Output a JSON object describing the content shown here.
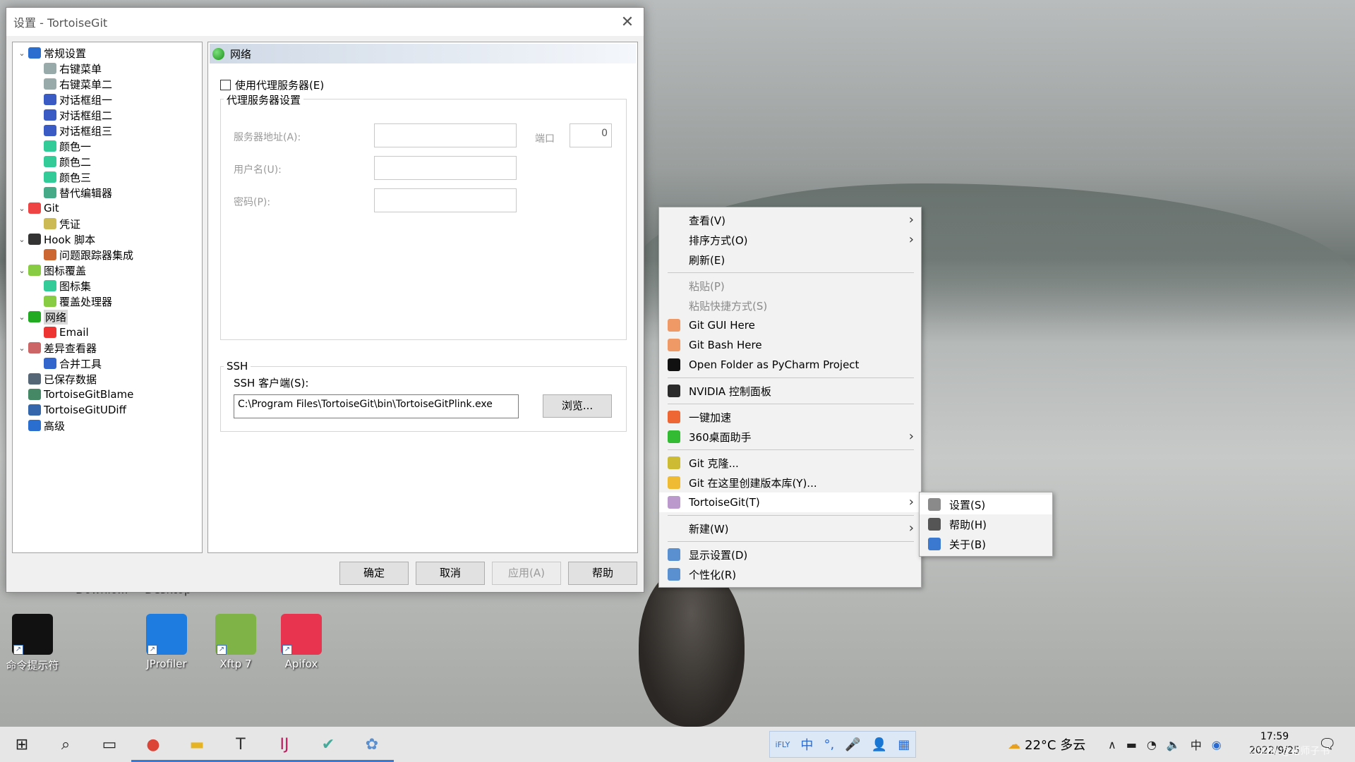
{
  "window": {
    "title": "设置 - TortoiseGit",
    "close": "✕"
  },
  "tree": [
    {
      "label": "常规设置",
      "icon": "wrench-icon",
      "level": 0,
      "exp": "v",
      "c": "#2a6fd0"
    },
    {
      "label": "右键菜单",
      "icon": "gear-icon",
      "level": 1,
      "c": "#9aa"
    },
    {
      "label": "右键菜单二",
      "icon": "gear-icon",
      "level": 1,
      "c": "#9aa"
    },
    {
      "label": "对话框组一",
      "icon": "windows-icon",
      "level": 1,
      "c": "#3b5bc4"
    },
    {
      "label": "对话框组二",
      "icon": "windows-icon",
      "level": 1,
      "c": "#3b5bc4"
    },
    {
      "label": "对话框组三",
      "icon": "windows-icon",
      "level": 1,
      "c": "#3b5bc4"
    },
    {
      "label": "颜色一",
      "icon": "palette-icon",
      "level": 1,
      "c": "#3c9"
    },
    {
      "label": "颜色二",
      "icon": "palette-icon",
      "level": 1,
      "c": "#3c9"
    },
    {
      "label": "颜色三",
      "icon": "palette-icon",
      "level": 1,
      "c": "#3c9"
    },
    {
      "label": "替代编辑器",
      "icon": "editor-icon",
      "level": 1,
      "c": "#4a8"
    },
    {
      "label": "Git",
      "icon": "git-icon",
      "level": 0,
      "exp": "v",
      "c": "#e44"
    },
    {
      "label": "凭证",
      "icon": "key-icon",
      "level": 1,
      "c": "#cb5"
    },
    {
      "label": "Hook 脚本",
      "icon": "hook-icon",
      "level": 0,
      "exp": "v",
      "c": "#333"
    },
    {
      "label": "问题跟踪器集成",
      "icon": "bug-icon",
      "level": 1,
      "c": "#c63"
    },
    {
      "label": "图标覆盖",
      "icon": "overlay-icon",
      "level": 0,
      "exp": "v",
      "c": "#8c4"
    },
    {
      "label": "图标集",
      "icon": "iconset-icon",
      "level": 1,
      "c": "#3c9"
    },
    {
      "label": "覆盖处理器",
      "icon": "overlay-handler-icon",
      "level": 1,
      "c": "#8c4"
    },
    {
      "label": "网络",
      "icon": "globe-icon",
      "level": 0,
      "exp": "v",
      "c": "#2a2",
      "sel": true
    },
    {
      "label": "Email",
      "icon": "at-icon",
      "level": 1,
      "c": "#e33"
    },
    {
      "label": "差异查看器",
      "icon": "magnifier-icon",
      "level": 0,
      "exp": "v",
      "c": "#c66"
    },
    {
      "label": "合并工具",
      "icon": "merge-icon",
      "level": 1,
      "c": "#36c"
    },
    {
      "label": "已保存数据",
      "icon": "gear-icon",
      "level": 0,
      "c": "#567"
    },
    {
      "label": "TortoiseGitBlame",
      "icon": "blame-icon",
      "level": 0,
      "c": "#486"
    },
    {
      "label": "TortoiseGitUDiff",
      "icon": "udiff-icon",
      "level": 0,
      "c": "#36a"
    },
    {
      "label": "高级",
      "icon": "wrench-icon",
      "level": 0,
      "c": "#2a6fd0"
    }
  ],
  "panel": {
    "header": "网络",
    "use_proxy": "使用代理服务器(E)",
    "proxy_group": "代理服务器设置",
    "server_label": "服务器地址(A):",
    "port_label": "端口",
    "port_value": "0",
    "user_label": "用户名(U):",
    "pass_label": "密码(P):",
    "ssh_group": "SSH",
    "ssh_client_label": "SSH 客户端(S):",
    "ssh_client_value": "C:\\Program Files\\TortoiseGit\\bin\\TortoiseGitPlink.exe",
    "browse": "浏览..."
  },
  "buttons": {
    "ok": "确定",
    "cancel": "取消",
    "apply": "应用(A)",
    "help": "帮助"
  },
  "desktop": {
    "ghost1": "Downlo...",
    "ghost2": "Desktop",
    "icons": [
      {
        "label": "命令提示符",
        "icon": "cmd-icon",
        "c": "#111"
      },
      {
        "label": "JProfiler",
        "icon": "jprofiler-icon",
        "c": "#1e7be0"
      },
      {
        "label": "Xftp 7",
        "icon": "xftp-icon",
        "c": "#7fb347"
      },
      {
        "label": "Apifox",
        "icon": "apifox-icon",
        "c": "#e8344e"
      }
    ]
  },
  "context_menu": [
    {
      "label": "查看(V)",
      "arrow": true
    },
    {
      "label": "排序方式(O)",
      "arrow": true
    },
    {
      "label": "刷新(E)"
    },
    {
      "sep": true
    },
    {
      "label": "粘贴(P)",
      "dis": true
    },
    {
      "label": "粘贴快捷方式(S)",
      "dis": true
    },
    {
      "label": "Git GUI Here",
      "icon": "git-gui-icon",
      "c": "#e96"
    },
    {
      "label": "Git Bash Here",
      "icon": "git-bash-icon",
      "c": "#e96"
    },
    {
      "label": "Open Folder as PyCharm Project",
      "icon": "pycharm-icon",
      "c": "#111"
    },
    {
      "sep": true
    },
    {
      "label": "NVIDIA 控制面板",
      "icon": "nvidia-icon",
      "c": "#2b2b2b"
    },
    {
      "sep": true
    },
    {
      "label": "一键加速",
      "icon": "speedup-icon",
      "c": "#e63"
    },
    {
      "label": "360桌面助手",
      "icon": "360-icon",
      "c": "#3b3",
      "arrow": true
    },
    {
      "sep": true
    },
    {
      "label": "Git 克隆...",
      "icon": "git-clone-icon",
      "c": "#cb3"
    },
    {
      "label": "Git 在这里创建版本库(Y)...",
      "icon": "git-create-repo-icon",
      "c": "#eb3"
    },
    {
      "label": "TortoiseGit(T)",
      "icon": "tortoisegit-icon",
      "c": "#b9c",
      "arrow": true,
      "hl": true
    },
    {
      "sep": true
    },
    {
      "label": "新建(W)",
      "arrow": true
    },
    {
      "sep": true
    },
    {
      "label": "显示设置(D)",
      "icon": "display-icon",
      "c": "#5a8fd0"
    },
    {
      "label": "个性化(R)",
      "icon": "personalize-icon",
      "c": "#5a8fd0"
    }
  ],
  "submenu": [
    {
      "label": "设置(S)",
      "icon": "wrench-icon",
      "hl": true
    },
    {
      "label": "帮助(H)",
      "icon": "help-icon"
    },
    {
      "label": "关于(B)",
      "icon": "info-icon"
    }
  ],
  "taskbar": {
    "apps": [
      {
        "icon": "start-icon",
        "g": "⊞",
        "run": false
      },
      {
        "icon": "search-icon",
        "g": "⌕",
        "run": false
      },
      {
        "icon": "task-view-icon",
        "g": "▭",
        "run": false
      },
      {
        "icon": "chrome-icon",
        "g": "●",
        "run": true,
        "c": "#db4437"
      },
      {
        "icon": "file-explorer-icon",
        "g": "▬",
        "run": true,
        "c": "#e6b422"
      },
      {
        "icon": "typora-icon",
        "g": "T",
        "run": true,
        "c": "#333"
      },
      {
        "icon": "intellij-icon",
        "g": "IJ",
        "run": true,
        "c": "#c2185b"
      },
      {
        "icon": "tortoisegit-settings-icon",
        "g": "✔",
        "run": true,
        "c": "#4a9"
      },
      {
        "icon": "tortoisegit-icon",
        "g": "✿",
        "run": true,
        "c": "#5a8fd0"
      }
    ],
    "ime": [
      "iFLY",
      "中",
      "°,",
      "🎤",
      "👤",
      "▦"
    ],
    "weather": "22°C 多云",
    "time": "17:59",
    "date": "2022/9/25",
    "watermark": "CSDN @诸师子书"
  }
}
